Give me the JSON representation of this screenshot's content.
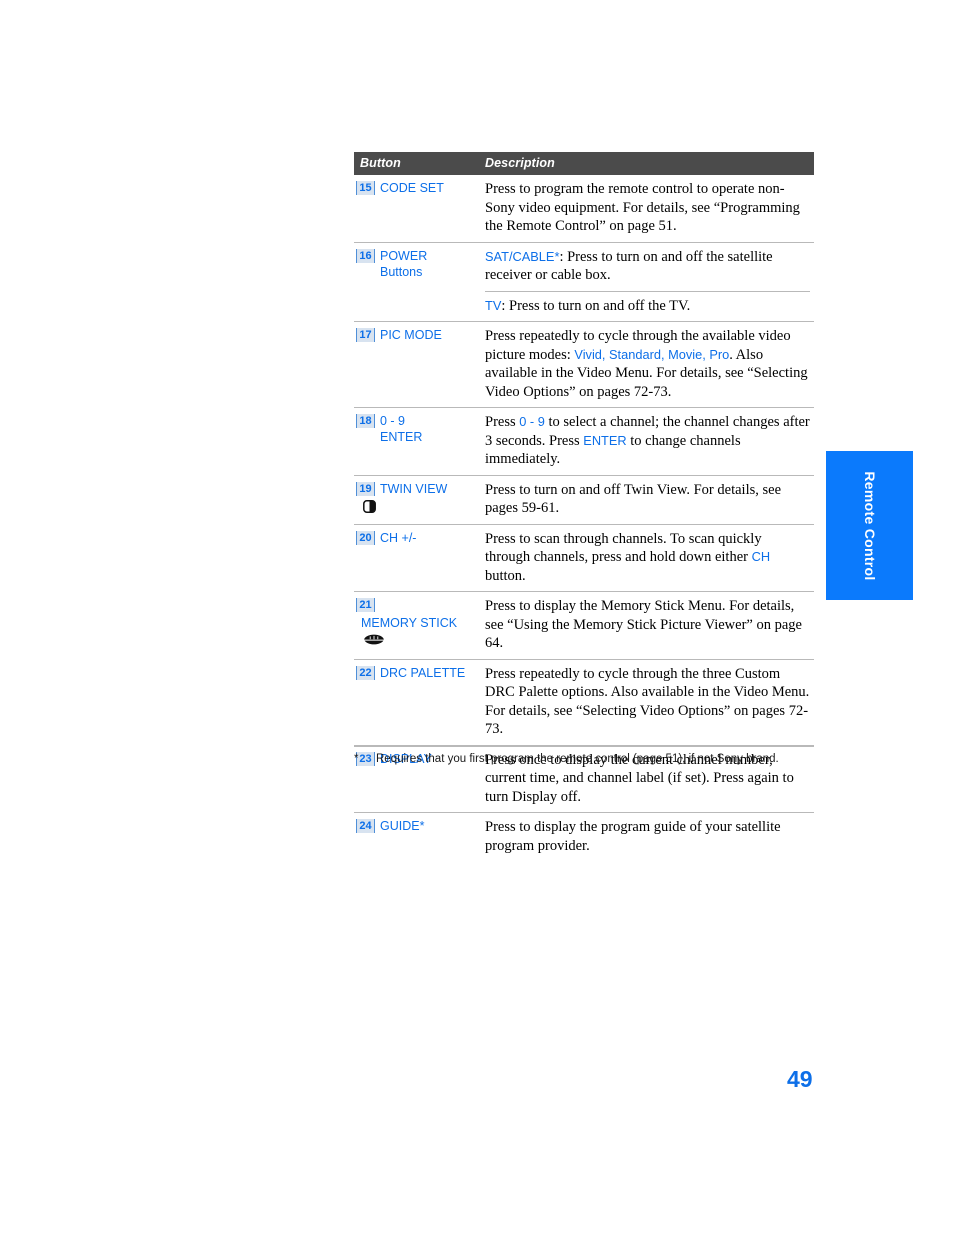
{
  "page": {
    "number": "49",
    "side_tab_label": "Remote Control",
    "accent_blue": "#0d6fe8",
    "tab_blue": "#0b7afc",
    "header_gray": "#4b4b4b"
  },
  "table": {
    "headers": {
      "button": "Button",
      "description": "Description"
    },
    "rows": [
      {
        "number": "15",
        "labels": [
          "CODE SET"
        ],
        "icon": null,
        "description_parts": [
          {
            "text": "Press to program the remote control to operate non-Sony video equipment. For details, see “Programming the Remote Control” on page 51.",
            "style": "plain"
          }
        ]
      },
      {
        "number": "16",
        "labels": [
          "POWER",
          "Buttons"
        ],
        "icon": null,
        "sub_rows": [
          {
            "parts": [
              {
                "text": "SAT/CABLE*",
                "style": "blue"
              },
              {
                "text": ": Press to turn on and off the satellite receiver or cable box.",
                "style": "plain"
              }
            ]
          },
          {
            "parts": [
              {
                "text": "TV",
                "style": "blue"
              },
              {
                "text": ": Press to turn on and off the TV.",
                "style": "plain"
              }
            ]
          }
        ]
      },
      {
        "number": "17",
        "labels": [
          "PIC MODE"
        ],
        "icon": null,
        "description_parts": [
          {
            "text": "Press repeatedly to cycle through the available video picture modes: ",
            "style": "plain"
          },
          {
            "text": "Vivid, Standard, Movie, Pro",
            "style": "blue"
          },
          {
            "text": ". Also available in the Video Menu. For details, see “Selecting Video Options” on pages 72-73.",
            "style": "plain"
          }
        ]
      },
      {
        "number": "18",
        "labels": [
          "0 - 9",
          "ENTER"
        ],
        "icon": null,
        "description_parts": [
          {
            "text": "Press ",
            "style": "plain"
          },
          {
            "text": "0 - 9",
            "style": "blue"
          },
          {
            "text": " to select a channel; the channel changes after 3 seconds. Press ",
            "style": "plain"
          },
          {
            "text": "ENTER",
            "style": "blue"
          },
          {
            "text": " to change channels immediately.",
            "style": "plain"
          }
        ]
      },
      {
        "number": "19",
        "labels": [
          "TWIN VIEW"
        ],
        "icon": "twin-view-icon",
        "description_parts": [
          {
            "text": "Press to turn on and off Twin View. For details, see pages 59-61.",
            "style": "plain"
          }
        ]
      },
      {
        "number": "20",
        "labels": [
          "CH +/-"
        ],
        "icon": null,
        "description_parts": [
          {
            "text": "Press to scan through channels. To scan quickly through channels, press and hold down either ",
            "style": "plain"
          },
          {
            "text": "CH",
            "style": "blue"
          },
          {
            "text": " button.",
            "style": "plain"
          }
        ]
      },
      {
        "number": "21",
        "labels": [
          "MEMORY STICK"
        ],
        "icon": "memory-stick-icon",
        "description_parts": [
          {
            "text": "Press to display the Memory Stick Menu. For details, see “Using the Memory Stick Picture Viewer” on page 64.",
            "style": "plain"
          }
        ]
      },
      {
        "number": "22",
        "labels": [
          "DRC PALETTE"
        ],
        "icon": null,
        "description_parts": [
          {
            "text": "Press repeatedly to cycle through the three Custom DRC Palette options. Also available in the Video Menu. For details, see “Selecting Video Options” on pages 72-73.",
            "style": "plain"
          }
        ]
      },
      {
        "number": "23",
        "labels": [
          "DISPLAY"
        ],
        "icon": null,
        "description_parts": [
          {
            "text": "Press once to display the current channel number, current time, and channel label (if set). Press again to turn Display off.",
            "style": "plain"
          }
        ]
      },
      {
        "number": "24",
        "labels": [
          "GUIDE*"
        ],
        "icon": null,
        "description_parts": [
          {
            "text": "Press to display the program guide of your satellite program provider.",
            "style": "plain"
          }
        ]
      }
    ]
  },
  "footnote": {
    "mark": "*",
    "text": "Requires that you first program the remote control (page 51), if not Sony brand."
  }
}
